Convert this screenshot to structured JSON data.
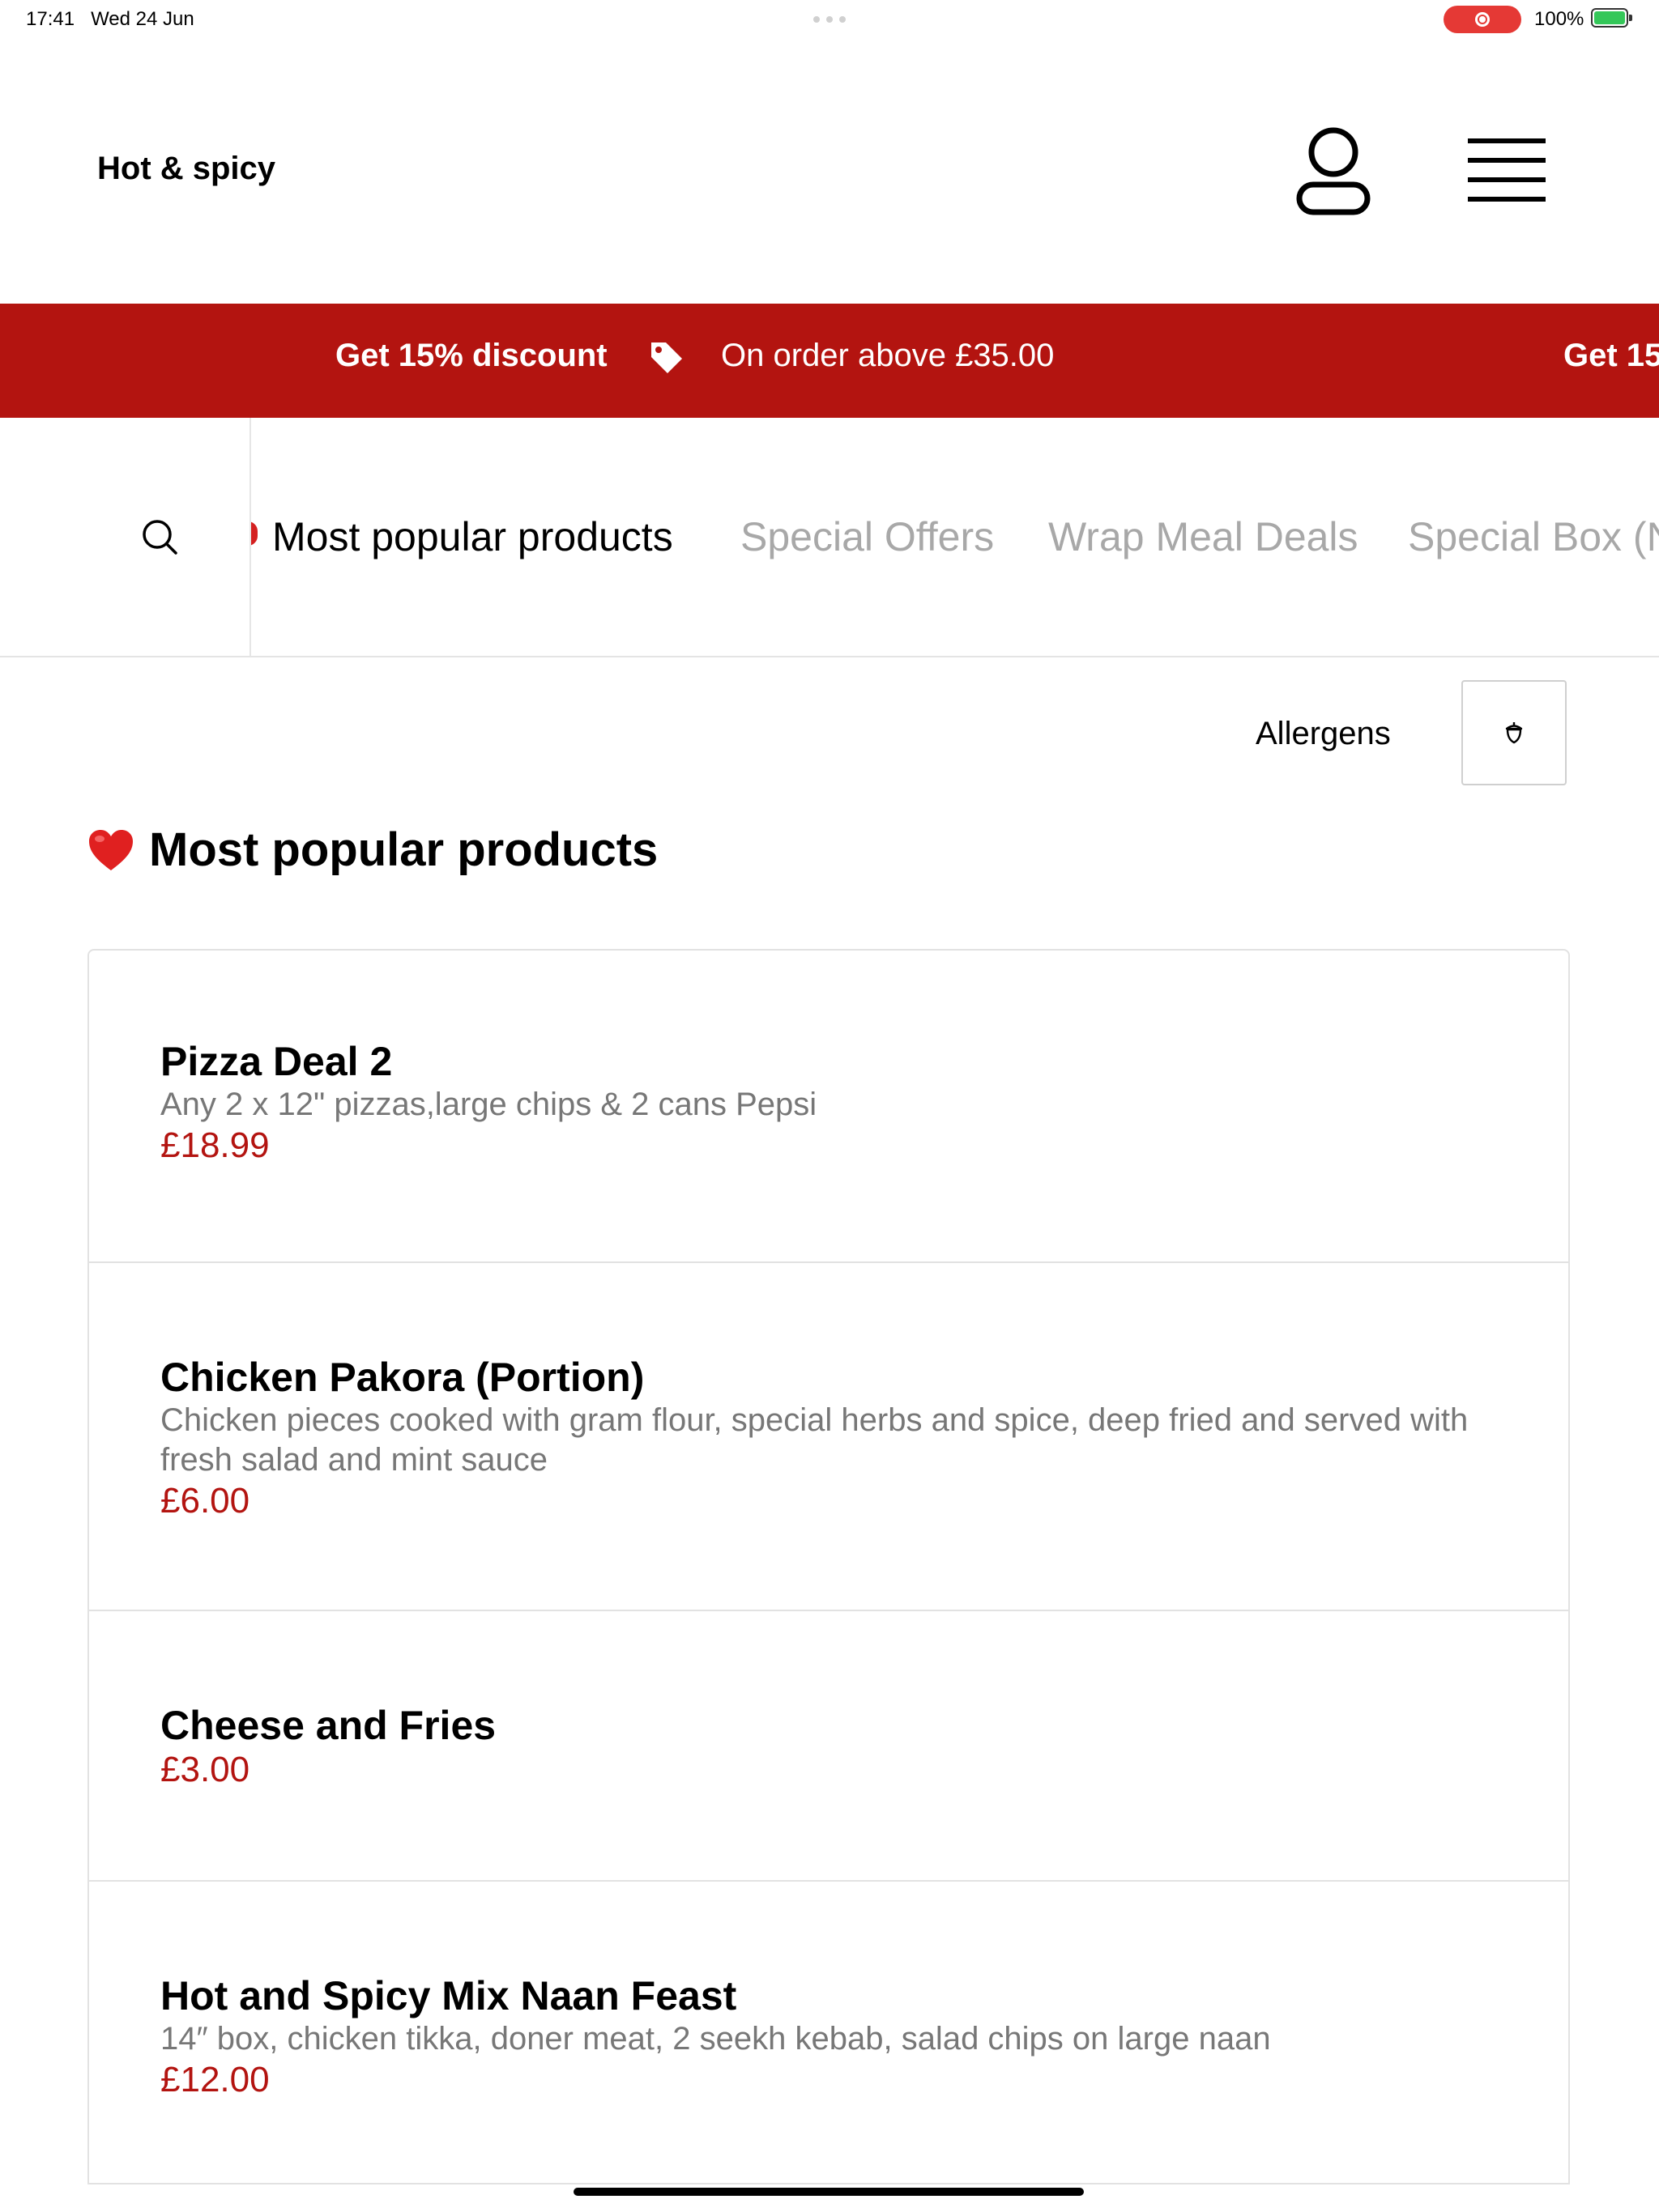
{
  "status_bar": {
    "time": "17:41",
    "date": "Wed 24 Jun",
    "battery": "100%"
  },
  "header": {
    "title": "Hot & spicy",
    "icons": [
      "user-icon",
      "menu-icon"
    ]
  },
  "promo_banner": {
    "headline": "Get 15% discount",
    "icon": "tag-icon",
    "detail": "On order above £35.00",
    "repeat_fragment": "Get 15"
  },
  "category_nav": {
    "search_icon": "search-icon",
    "tabs": [
      {
        "label": "Most popular products",
        "active": true
      },
      {
        "label": "Special Offers",
        "active": false
      },
      {
        "label": "Wrap Meal Deals",
        "active": false
      },
      {
        "label": "Special Box (N",
        "active": false
      }
    ]
  },
  "allergens": {
    "label": "Allergens",
    "icon": "acorn-icon"
  },
  "section": {
    "emoji": "❤️",
    "title": "Most popular products"
  },
  "products": [
    {
      "name": "Pizza Deal 2",
      "description": "Any 2 x 12\" pizzas,large chips & 2 cans Pepsi",
      "price": "£18.99"
    },
    {
      "name": "Chicken Pakora (Portion)",
      "description_lines": [
        "Chicken pieces cooked with gram flour, special herbs and spice, deep fried and served with",
        "fresh salad and mint sauce"
      ],
      "price": "£6.00"
    },
    {
      "name": "Cheese and Fries",
      "price": "£3.00"
    },
    {
      "name": "Hot and Spicy Mix Naan Feast",
      "description": "14″ box, chicken tikka, doner meat, 2 seekh kebab, salad chips on large naan",
      "price": "£12.00"
    }
  ],
  "colors": {
    "brand_red": "#b31410",
    "inactive_tab": "#a8a8a8",
    "description_gray": "#777777",
    "record_red": "#e53935",
    "battery_green": "#34c759"
  }
}
